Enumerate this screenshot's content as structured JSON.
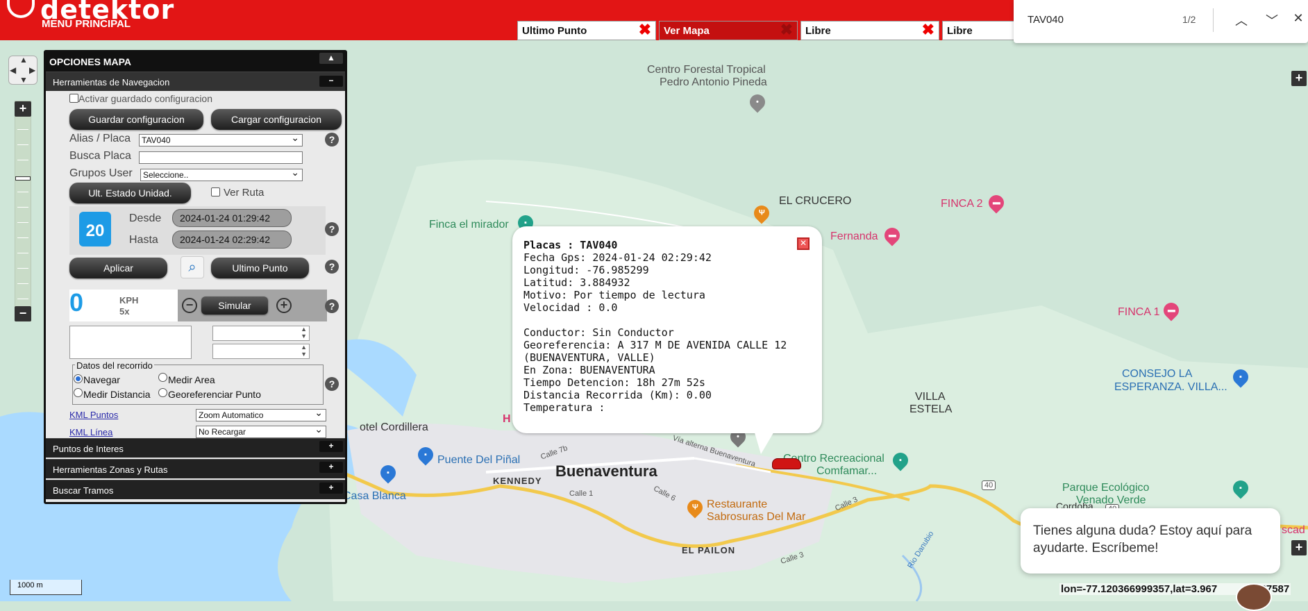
{
  "header": {
    "logo_text": "detektor",
    "menu_label": "MENU PRINCIPAL",
    "tabs": [
      {
        "label": "Ultimo Punto",
        "close": "✖"
      },
      {
        "label": "Ver Mapa",
        "close": "✖"
      },
      {
        "label": "Libre",
        "close": "✖"
      },
      {
        "label": "Libre",
        "close": ""
      }
    ]
  },
  "find_bar": {
    "query": "TAV040",
    "count": "1/2",
    "prev_icon": "chevron-up-icon",
    "next_icon": "chevron-down-icon",
    "close_icon": "close-icon"
  },
  "map_labels": {
    "centro_forestal": "Centro Forestal Tropical",
    "centro_forestal2": "Pedro Antonio Pineda",
    "el_crucero": "EL CRUCERO",
    "finca_mirador": "Finca el mirador",
    "fernanda": "Fernanda",
    "finca2": "FINCA 2",
    "finca1": "FINCA 1",
    "consejo1": "CONSEJO LA",
    "consejo2": "ESPERANZA. VILLA...",
    "villa1": "VILLA",
    "villa2": "ESTELA",
    "hotel": "otel Cordillera",
    "puente": "Puente Del Piñal",
    "kennedy": "KENNEDY",
    "buenaventura": "Buenaventura",
    "casa_blanca": "Casa Blanca",
    "calle1": "Calle 1",
    "calle6": "Calle 6",
    "calle7b": "Calle 7b",
    "calle3": "Calle 3",
    "calle3b": "Calle 3",
    "via_alterna": "Vía alterna Buenaventura",
    "restaurante1": "Restaurante",
    "restaurante2": "Sabrosuras Del Mar",
    "el_pailon": "EL PAILON",
    "centro_rec1": "Centro Recreacional",
    "centro_rec2": "Comfamar...",
    "parque1": "Parque Ecológico",
    "parque2": "Venado Verde",
    "cordoba": "Cordoba",
    "rio": "Rio Danubio",
    "route40a": "40",
    "route40b": "40",
    "escad": "scad",
    "h_label": "H"
  },
  "panel": {
    "title": "OPCIONES MAPA",
    "nav_section": "Herramientas de Navegacion",
    "activar": "Activar guardado configuracion",
    "guardar": "Guardar configuracion",
    "cargar": "Cargar configuracion",
    "alias_label": "Alias / Placa",
    "alias_value": "TAV040",
    "busca_label": "Busca Placa",
    "grupos_label": "Grupos User",
    "grupos_value": "Seleccione..",
    "ult_estado": "Ult. Estado Unidad.",
    "ver_ruta": "Ver Ruta",
    "calendar_day": "20",
    "desde_label": "Desde",
    "desde_value": "2024-01-24 01:29:42",
    "hasta_label": "Hasta",
    "hasta_value": "2024-01-24 02:29:42",
    "aplicar": "Aplicar",
    "ultimo_punto": "Ultimo Punto",
    "speed_value": "0",
    "speed_unit": "KPH",
    "speed_mult": "5x",
    "simular": "Simular",
    "datos_legend": "Datos del recorrido",
    "navegar": "Navegar",
    "medir_area": "Medir Area",
    "medir_distancia": "Medir Distancia",
    "georef_punto": "Georeferenciar Punto",
    "kml_puntos": "KML Puntos",
    "kml_puntos_value": "Zoom Automatico",
    "kml_linea": "KML Línea",
    "kml_linea_value": "No Recargar",
    "puntos_interes": "Puntos de Interes",
    "zonas_rutas": "Herramientas Zonas y Rutas",
    "buscar_tramos": "Buscar Tramos",
    "help": "?"
  },
  "popup": {
    "placas": "Placas : TAV040",
    "fecha": "Fecha Gps: 2024-01-24 02:29:42",
    "longitud": "Longitud: -76.985299",
    "latitud": "Latitud: 3.884932",
    "motivo": "Motivo: Por tiempo de lectura",
    "velocidad": "Velocidad : 0.0",
    "conductor": "Conductor: Sin Conductor",
    "georef1": "Georeferencia: A 317 M DE AVENIDA CALLE 12",
    "georef2": "(BUENAVENTURA, VALLE)",
    "zona": "En Zona: BUENAVENTURA",
    "tiempo": "Tiempo Detencion: 18h 27m 52s",
    "distancia": "Distancia Recorrida (Km): 0.00",
    "temperatura": "Temperatura :",
    "close": "✕"
  },
  "chat": {
    "text": "Tienes alguna duda? Estoy aquí para ayudarte. Escríbeme!"
  },
  "status": {
    "coords": "lon=-77.120366999357,lat=3.967",
    "coords_tail": "937587",
    "scale": "1000 m"
  },
  "colors": {
    "brand_red": "#e21515",
    "water": "#aadaff",
    "land": "#cfe6d8"
  }
}
